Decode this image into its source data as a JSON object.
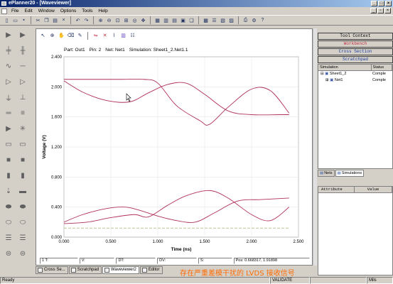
{
  "window": {
    "title": "ePlanner20 - [Waveviewer]"
  },
  "menu": [
    "File",
    "Edit",
    "Window",
    "Options",
    "Tools",
    "Help"
  ],
  "plot_header": {
    "part": "Part: Out1",
    "pin": "Pin: 2",
    "net": "Net: Net1",
    "simulation": "Simulation: Sheet1_2.Net1.1"
  },
  "plot_status": {
    "t1": "1 T:",
    "v": "V:",
    "dt": "DT:",
    "dv": "DV:",
    "s": "S:",
    "pos": "Pos: 0.668317, 1.91898"
  },
  "tabs": [
    "Cross Se...",
    "Scratchpad",
    "Waveviewer2",
    "Editor"
  ],
  "annotation": "存在严重差模干扰的 LVDS 接收信号",
  "status_bar": {
    "left": "Ready",
    "mode": "VALIDATE",
    "unit": "Mils"
  },
  "right_panel": {
    "buttons": [
      "Tool Context",
      "Workbench",
      "Cross Section",
      "Scratchpad"
    ],
    "tree_headers": [
      "Simulation",
      "Status"
    ],
    "tree_rows": [
      {
        "name": "Sheet1_2",
        "status": "Comple"
      },
      {
        "name": "Net1",
        "status": "Comple"
      }
    ],
    "tabs": [
      "Nets",
      "Simulations"
    ],
    "attr_headers": [
      "Attribute",
      "Value"
    ]
  },
  "chart_data": {
    "type": "line",
    "xlabel": "Time (ns)",
    "ylabel": "Voltage (V)",
    "xlim": [
      0,
      2.5
    ],
    "ylim": [
      0,
      2.4
    ],
    "x_ticks": [
      "0.000",
      "0.500",
      "1.000",
      "1.500",
      "2.000",
      "2.500"
    ],
    "y_ticks": [
      "0.000",
      "0.400",
      "0.800",
      "1.200",
      "1.600",
      "2.000",
      "2.400"
    ],
    "grid": true,
    "colors": {
      "trace": "#b0305a",
      "reference": "#c8c8a0",
      "grid": "#e6e6e6"
    },
    "series": [
      {
        "x": [
          0,
          0.3,
          0.6,
          0.85,
          1.0,
          1.2,
          1.45,
          1.55,
          1.75,
          2.0,
          2.2,
          2.4
        ],
        "y": [
          2.1,
          2.1,
          2.1,
          2.1,
          2.05,
          1.75,
          1.55,
          1.5,
          1.73,
          1.97,
          1.95,
          1.65
        ]
      },
      {
        "x": [
          0,
          0.2,
          0.45,
          0.7,
          0.9,
          1.1,
          1.3,
          1.5,
          1.75,
          2.0,
          2.3,
          2.4
        ],
        "y": [
          2.08,
          1.93,
          1.82,
          1.8,
          1.92,
          2.03,
          2.05,
          1.9,
          1.68,
          1.63,
          1.63,
          1.63
        ]
      },
      {
        "x": [
          0,
          0.2,
          0.45,
          0.65,
          0.8,
          1.0,
          1.2,
          1.4,
          1.6,
          1.85,
          2.1,
          2.4
        ],
        "y": [
          0.2,
          0.3,
          0.38,
          0.4,
          0.36,
          0.28,
          0.22,
          0.2,
          0.32,
          0.48,
          0.5,
          0.52
        ]
      },
      {
        "x": [
          0,
          0.25,
          0.5,
          0.75,
          0.9,
          1.1,
          1.3,
          1.55,
          1.75,
          2.0,
          2.2,
          2.4
        ],
        "y": [
          0.18,
          0.2,
          0.26,
          0.3,
          0.27,
          0.42,
          0.55,
          0.62,
          0.52,
          0.3,
          0.22,
          0.4
        ]
      },
      {
        "x": [
          0,
          2.4
        ],
        "y": [
          0.12,
          0.12
        ]
      }
    ]
  }
}
